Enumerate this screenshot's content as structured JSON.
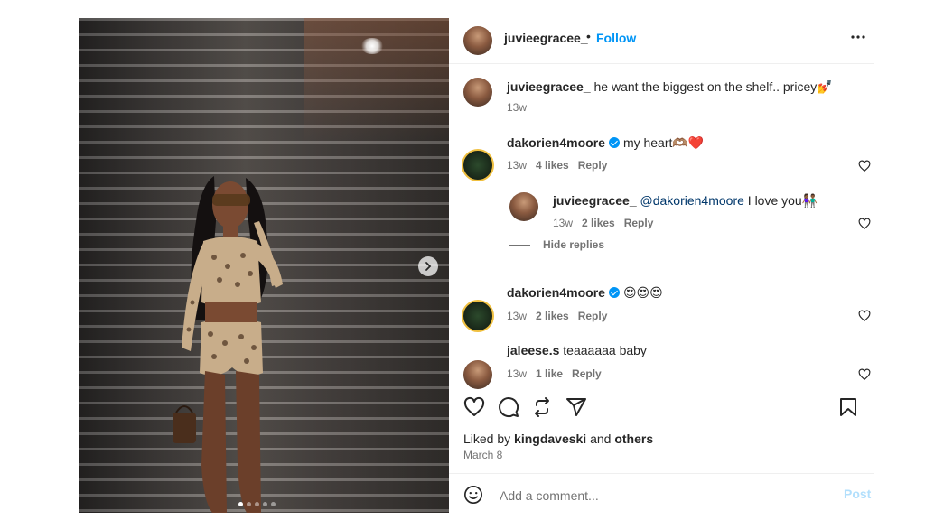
{
  "post": {
    "author": "juvieegracee_",
    "separator": "•",
    "follow_label": "Follow",
    "more_label": "•••",
    "caption": {
      "username": "juvieegracee_",
      "text": "he want the biggest on the shelf.. pricey💅",
      "time": "13w"
    },
    "carousel": {
      "slide_count": 5,
      "active_slide": 1
    }
  },
  "comments": [
    {
      "username": "dakorien4moore",
      "verified": true,
      "text": "my heart🫶🏽❤️",
      "time": "13w",
      "likes": "4 likes",
      "reply_label": "Reply"
    },
    {
      "username": "juvieegracee_",
      "mention": "@dakorien4moore",
      "text": "I love you👫🏾",
      "time": "13w",
      "likes": "2 likes",
      "reply_label": "Reply"
    },
    {
      "username": "dakorien4moore",
      "verified": true,
      "text": "😍😍😍",
      "time": "13w",
      "likes": "2 likes",
      "reply_label": "Reply"
    },
    {
      "username": "jaleese.s",
      "text": "teaaaaaa baby",
      "time": "13w",
      "likes": "1 like",
      "reply_label": "Reply"
    }
  ],
  "hide_replies_label": "Hide replies",
  "likes_summary": {
    "prefix": "Liked by",
    "user": "kingdaveski",
    "joiner": "and",
    "others": "others"
  },
  "post_date": "March 8",
  "add_comment": {
    "placeholder": "Add a comment...",
    "post_label": "Post"
  },
  "colors": {
    "accent": "#0095f6",
    "post_disabled": "#b2dffc",
    "secondary_text": "#737373",
    "primary_text": "#262626"
  }
}
